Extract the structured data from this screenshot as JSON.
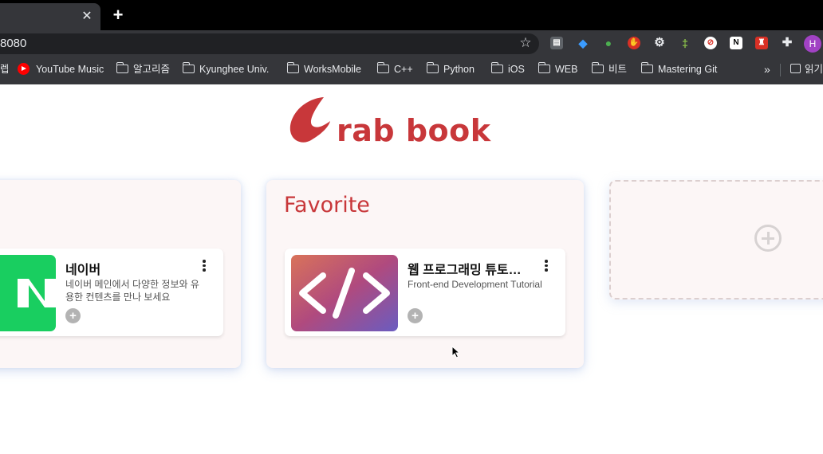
{
  "browser": {
    "tab_close": "✕",
    "new_tab": "+",
    "url": "8080",
    "bookmark_star": "☆",
    "profile_initial": "H",
    "bookmarks": [
      {
        "label": "YouTube Music",
        "icon": "youtube-music-icon"
      },
      {
        "label": "알고리즘",
        "icon": "folder-icon"
      },
      {
        "label": "Kyunghee Univ.",
        "icon": "folder-icon"
      },
      {
        "label": "WorksMobile",
        "icon": "folder-icon"
      },
      {
        "label": "C++",
        "icon": "folder-icon"
      },
      {
        "label": "Python",
        "icon": "folder-icon"
      },
      {
        "label": "iOS",
        "icon": "folder-icon"
      },
      {
        "label": "WEB",
        "icon": "folder-icon"
      },
      {
        "label": "비트",
        "icon": "folder-icon"
      },
      {
        "label": "Mastering Git",
        "icon": "folder-icon"
      }
    ],
    "bookmark_overflow": "»",
    "reading_list": "읽기",
    "left_cut_label": "렙"
  },
  "app": {
    "logo_text": "rab book",
    "brand_color": "#c8373a",
    "panels": [
      {
        "title": "",
        "cards": [
          {
            "title": "네이버",
            "description": "네이버 메인에서 다양한 정보와 유용한 컨텐츠를 만나 보세요",
            "thumb_icon": "naver-logo-icon",
            "thumb_color": "#19ce60"
          }
        ]
      },
      {
        "title": "Favorite",
        "cards": [
          {
            "title": "웹 프로그래밍 튜토…",
            "description": "Front-end Development Tutorial",
            "thumb_icon": "code-brackets-icon"
          }
        ]
      }
    ],
    "add_button_icon": "plus-circle-icon",
    "card_add_label": "+"
  }
}
